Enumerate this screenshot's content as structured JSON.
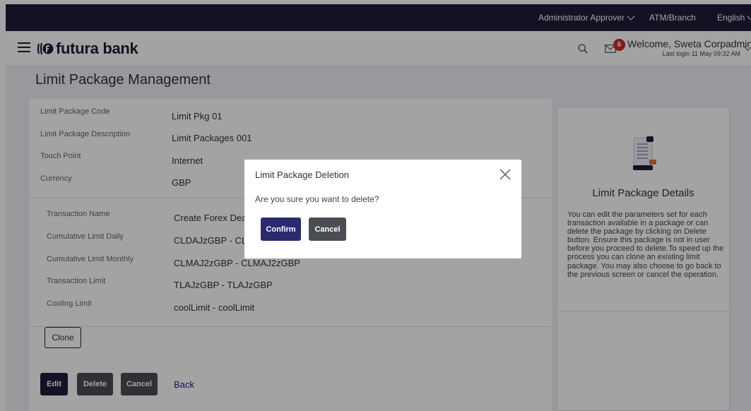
{
  "topbar": {
    "role": "Administrator Approver",
    "branch": "ATM/Branch",
    "language": "English"
  },
  "header": {
    "logo_text": "futura bank",
    "mail_count": "6",
    "welcome": "Welcome, Sweta Corpadmin",
    "last_login": "Last login 11 May 09:32 AM"
  },
  "page": {
    "title": "Limit Package Management"
  },
  "package_fields": [
    {
      "label": "Limit Package Code",
      "value": "Limit Pkg 01"
    },
    {
      "label": "Limit Package Description",
      "value": "Limit Packages 001"
    },
    {
      "label": "Touch Point",
      "value": "Internet"
    },
    {
      "label": "Currency",
      "value": "GBP"
    }
  ],
  "transaction_fields": [
    {
      "label": "Transaction Name",
      "value": "Create Forex Deal"
    },
    {
      "label": "Cumulative Limit Daily",
      "value": "CLDAJzGBP - CLDAJzGBP"
    },
    {
      "label": "Cumulative Limit Monthly",
      "value": "CLMAJ2zGBP - CLMAJ2zGBP"
    },
    {
      "label": "Transaction Limit",
      "value": "TLAJzGBP - TLAJzGBP"
    },
    {
      "label": "Cooling Limit",
      "value": "coolLimit - coolLimit"
    }
  ],
  "actions": {
    "clone": "Clone",
    "edit": "Edit",
    "delete": "Delete",
    "cancel": "Cancel",
    "back": "Back"
  },
  "side_panel": {
    "title": "Limit Package Details",
    "text": "You can edit the parameters set for each transaction available in a package or can delete the package by clicking on Delete button. Ensure this package is not in user before you proceed to delete.To speed up the process you can clone an existing limit package. You may also choose to go back to the previous screen or cancel the operation."
  },
  "modal": {
    "title": "Limit Package Deletion",
    "question": "Are you sure you want to delete?",
    "confirm": "Confirm",
    "cancel": "Cancel"
  },
  "colors": {
    "topbar": "#1f1d3b",
    "primary_button": "#2c2a6e",
    "secondary_button": "#4a4d54",
    "badge": "#cc2d2d"
  },
  "icons": [
    "menu-icon",
    "logo-icon",
    "search-icon",
    "mail-icon",
    "chevron-down-icon",
    "document-icon",
    "close-icon"
  ]
}
